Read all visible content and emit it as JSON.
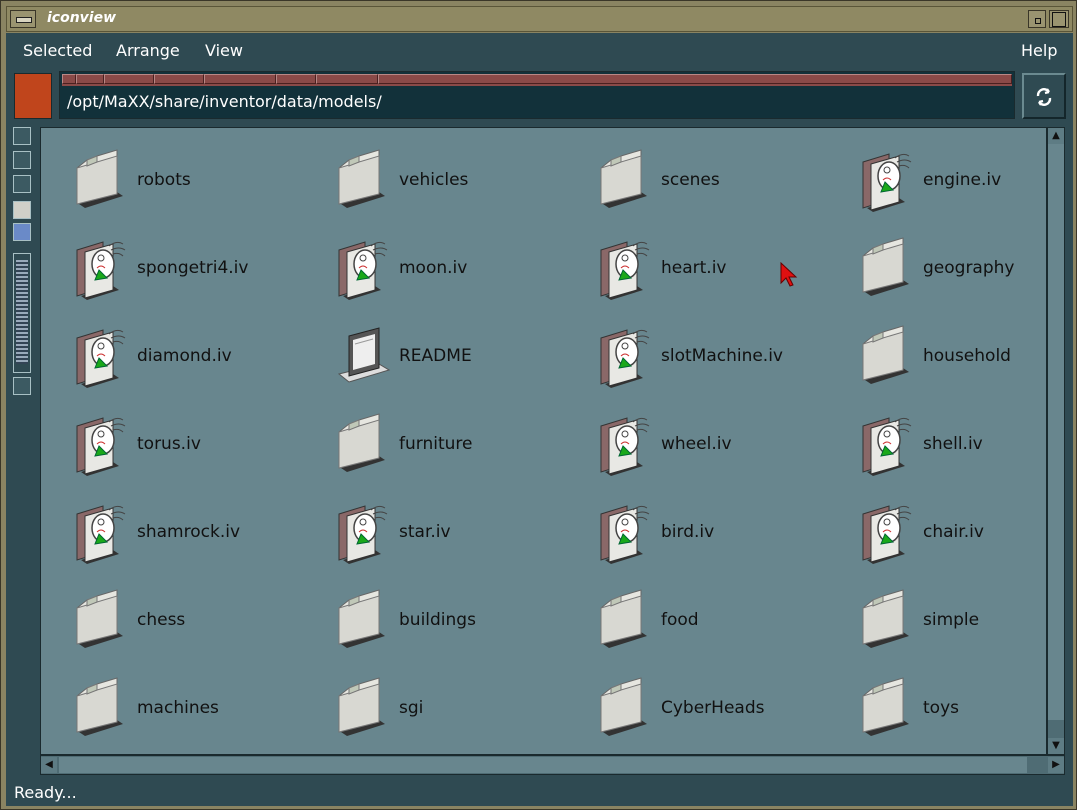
{
  "window": {
    "title": "iconview"
  },
  "menubar": {
    "selected": "Selected",
    "arrange": "Arrange",
    "view": "View",
    "help": "Help"
  },
  "path": {
    "value": "/opt/MaXX/share/inventor/data/models/"
  },
  "status": {
    "text": "Ready..."
  },
  "colors": {
    "accent_swatch": "#c0451c",
    "icon_area_bg": "#68868e"
  },
  "items": [
    {
      "label": "robots",
      "icon": "folder-icon"
    },
    {
      "label": "vehicles",
      "icon": "folder-icon"
    },
    {
      "label": "scenes",
      "icon": "folder-icon"
    },
    {
      "label": "engine.iv",
      "icon": "inventor-file-icon"
    },
    {
      "label": "spongetri4.iv",
      "icon": "inventor-file-icon"
    },
    {
      "label": "moon.iv",
      "icon": "inventor-file-icon"
    },
    {
      "label": "heart.iv",
      "icon": "inventor-file-icon"
    },
    {
      "label": "geography",
      "icon": "folder-icon"
    },
    {
      "label": "diamond.iv",
      "icon": "inventor-file-icon"
    },
    {
      "label": "README",
      "icon": "text-file-icon"
    },
    {
      "label": "slotMachine.iv",
      "icon": "inventor-file-icon"
    },
    {
      "label": "household",
      "icon": "folder-icon"
    },
    {
      "label": "torus.iv",
      "icon": "inventor-file-icon"
    },
    {
      "label": "furniture",
      "icon": "folder-icon"
    },
    {
      "label": "wheel.iv",
      "icon": "inventor-file-icon"
    },
    {
      "label": "shell.iv",
      "icon": "inventor-file-icon"
    },
    {
      "label": "shamrock.iv",
      "icon": "inventor-file-icon"
    },
    {
      "label": "star.iv",
      "icon": "inventor-file-icon"
    },
    {
      "label": "bird.iv",
      "icon": "inventor-file-icon"
    },
    {
      "label": "chair.iv",
      "icon": "inventor-file-icon"
    },
    {
      "label": "chess",
      "icon": "folder-icon"
    },
    {
      "label": "buildings",
      "icon": "folder-icon"
    },
    {
      "label": "food",
      "icon": "folder-icon"
    },
    {
      "label": "simple",
      "icon": "folder-icon"
    },
    {
      "label": "machines",
      "icon": "folder-icon"
    },
    {
      "label": "sgi",
      "icon": "folder-icon"
    },
    {
      "label": "CyberHeads",
      "icon": "folder-icon"
    },
    {
      "label": "toys",
      "icon": "folder-icon"
    }
  ]
}
